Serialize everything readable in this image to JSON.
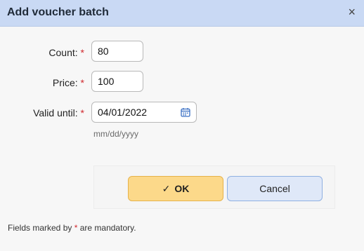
{
  "dialog": {
    "title": "Add voucher batch",
    "close_glyph": "×"
  },
  "form": {
    "count": {
      "label": "Count:",
      "required_mark": "*",
      "value": "80"
    },
    "price": {
      "label": "Price:",
      "required_mark": "*",
      "value": "100"
    },
    "valid_until": {
      "label": "Valid until:",
      "required_mark": "*",
      "value": "04/01/2022",
      "hint": "mm/dd/yyyy",
      "icon": "calendar-icon"
    }
  },
  "buttons": {
    "ok_check": "✓",
    "ok_label": "OK",
    "cancel_label": "Cancel"
  },
  "footer": {
    "prefix": "Fields marked by",
    "mark": "*",
    "suffix": "are mandatory."
  },
  "colors": {
    "titlebar": "#c9d9f4",
    "ok_button": "#fcd98a",
    "cancel_button": "#dfe8f8",
    "required": "#d0282e"
  }
}
